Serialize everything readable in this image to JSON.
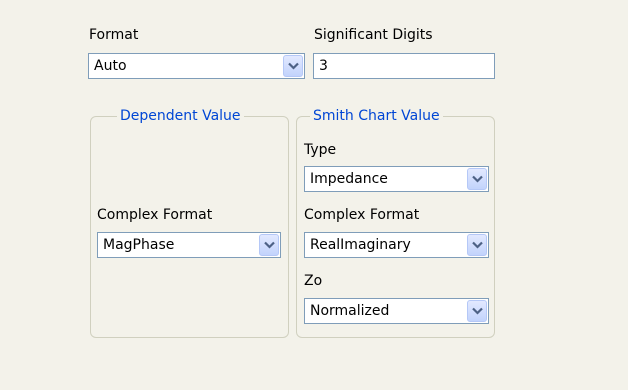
{
  "format": {
    "label": "Format",
    "value": "Auto"
  },
  "significant_digits": {
    "label": "Significant Digits",
    "value": "3"
  },
  "dependent_value": {
    "title": "Dependent Value",
    "complex_format_label": "Complex Format",
    "complex_format_value": "MagPhase"
  },
  "smith_chart_value": {
    "title": "Smith Chart Value",
    "type_label": "Type",
    "type_value": "Impedance",
    "complex_format_label": "Complex Format",
    "complex_format_value": "RealImaginary",
    "zo_label": "Zo",
    "zo_value": "Normalized"
  },
  "icons": {
    "dropdown": "chevron-down-icon"
  }
}
